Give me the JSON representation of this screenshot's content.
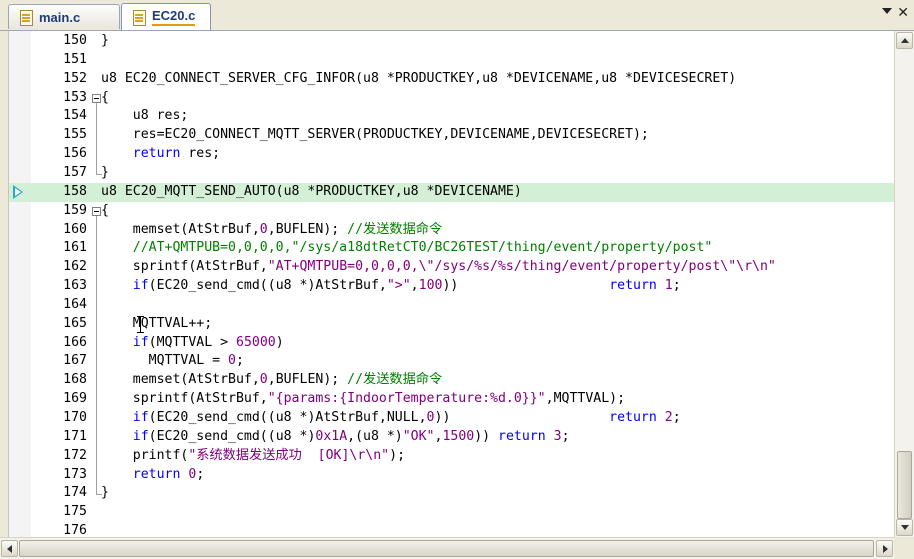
{
  "tabs": [
    {
      "label": "main.c",
      "active": false
    },
    {
      "label": "EC20.c",
      "active": true
    }
  ],
  "editor": {
    "current_line": "158",
    "lines": [
      {
        "n": "150",
        "tokens": [
          [
            "p",
            "}"
          ]
        ]
      },
      {
        "n": "151",
        "tokens": []
      },
      {
        "n": "152",
        "tokens": [
          [
            "p",
            "u8 EC20_CONNECT_SERVER_CFG_INFOR(u8 *PRODUCTKEY,u8 *DEVICENAME,u8 *DEVICESECRET)"
          ]
        ]
      },
      {
        "n": "153",
        "tokens": [
          [
            "p",
            "{"
          ]
        ]
      },
      {
        "n": "154",
        "tokens": [
          [
            "p",
            "    u8 res;"
          ]
        ]
      },
      {
        "n": "155",
        "tokens": [
          [
            "p",
            "    res=EC20_CONNECT_MQTT_SERVER(PRODUCTKEY,DEVICENAME,DEVICESECRET);"
          ]
        ]
      },
      {
        "n": "156",
        "tokens": [
          [
            "p",
            "    "
          ],
          [
            "kw",
            "return"
          ],
          [
            "p",
            " res;"
          ]
        ]
      },
      {
        "n": "157",
        "tokens": [
          [
            "p",
            "}"
          ]
        ]
      },
      {
        "n": "158",
        "tokens": [
          [
            "p",
            "u8 EC20_MQTT_SEND_AUTO(u8 *PRODUCTKEY,u8 *DEVICENAME)"
          ]
        ]
      },
      {
        "n": "159",
        "tokens": [
          [
            "p",
            "{"
          ]
        ]
      },
      {
        "n": "160",
        "tokens": [
          [
            "p",
            "    memset(AtStrBuf,"
          ],
          [
            "num",
            "0"
          ],
          [
            "p",
            ",BUFLEN); "
          ],
          [
            "cmt",
            "//发送数据命令"
          ]
        ]
      },
      {
        "n": "161",
        "tokens": [
          [
            "cmt",
            "    //AT+QMTPUB=0,0,0,0,\"/sys/a18dtRetCT0/BC26TEST/thing/event/property/post\""
          ]
        ]
      },
      {
        "n": "162",
        "tokens": [
          [
            "p",
            "    sprintf(AtStrBuf,"
          ],
          [
            "str",
            "\"AT+QMTPUB=0,0,0,0,\\\"/sys/%s/%s/thing/event/property/post\\\"\\r\\n\""
          ]
        ]
      },
      {
        "n": "163",
        "tokens": [
          [
            "p",
            "    "
          ],
          [
            "kw",
            "if"
          ],
          [
            "p",
            "(EC20_send_cmd((u8 *)AtStrBuf,"
          ],
          [
            "str",
            "\">\""
          ],
          [
            "p",
            ","
          ],
          [
            "num",
            "100"
          ],
          [
            "p",
            "))                   "
          ],
          [
            "kw",
            "return"
          ],
          [
            "p",
            " "
          ],
          [
            "num",
            "1"
          ],
          [
            "p",
            ";"
          ]
        ]
      },
      {
        "n": "164",
        "tokens": []
      },
      {
        "n": "165",
        "tokens": [
          [
            "p",
            "    MQTTVAL++;"
          ]
        ]
      },
      {
        "n": "166",
        "tokens": [
          [
            "p",
            "    "
          ],
          [
            "kw",
            "if"
          ],
          [
            "p",
            "(MQTTVAL > "
          ],
          [
            "num",
            "65000"
          ],
          [
            "p",
            ")"
          ]
        ]
      },
      {
        "n": "167",
        "tokens": [
          [
            "p",
            "      MQTTVAL = "
          ],
          [
            "num",
            "0"
          ],
          [
            "p",
            ";"
          ]
        ]
      },
      {
        "n": "168",
        "tokens": [
          [
            "p",
            "    memset(AtStrBuf,"
          ],
          [
            "num",
            "0"
          ],
          [
            "p",
            ",BUFLEN); "
          ],
          [
            "cmt",
            "//发送数据命令"
          ]
        ]
      },
      {
        "n": "169",
        "tokens": [
          [
            "p",
            "    sprintf(AtStrBuf,"
          ],
          [
            "str",
            "\"{params:{IndoorTemperature:%d.0}}\""
          ],
          [
            "p",
            ",MQTTVAL);"
          ]
        ]
      },
      {
        "n": "170",
        "tokens": [
          [
            "p",
            "    "
          ],
          [
            "kw",
            "if"
          ],
          [
            "p",
            "(EC20_send_cmd((u8 *)AtStrBuf,NULL,"
          ],
          [
            "num",
            "0"
          ],
          [
            "p",
            "))                    "
          ],
          [
            "kw",
            "return"
          ],
          [
            "p",
            " "
          ],
          [
            "num",
            "2"
          ],
          [
            "p",
            ";"
          ]
        ]
      },
      {
        "n": "171",
        "tokens": [
          [
            "p",
            "    "
          ],
          [
            "kw",
            "if"
          ],
          [
            "p",
            "(EC20_send_cmd((u8 *)"
          ],
          [
            "num",
            "0x1A"
          ],
          [
            "p",
            ",(u8 *)"
          ],
          [
            "str",
            "\"OK\""
          ],
          [
            "p",
            ","
          ],
          [
            "num",
            "1500"
          ],
          [
            "p",
            ")) "
          ],
          [
            "kw",
            "return"
          ],
          [
            "p",
            " "
          ],
          [
            "num",
            "3"
          ],
          [
            "p",
            ";"
          ]
        ]
      },
      {
        "n": "172",
        "tokens": [
          [
            "p",
            "    printf("
          ],
          [
            "str",
            "\"系统数据发送成功  [OK]\\r\\n\""
          ],
          [
            "p",
            ");"
          ]
        ]
      },
      {
        "n": "173",
        "tokens": [
          [
            "p",
            "    "
          ],
          [
            "kw",
            "return"
          ],
          [
            "p",
            " "
          ],
          [
            "num",
            "0"
          ],
          [
            "p",
            ";"
          ]
        ]
      },
      {
        "n": "174",
        "tokens": [
          [
            "p",
            "}"
          ]
        ]
      },
      {
        "n": "175",
        "tokens": []
      },
      {
        "n": "176",
        "tokens": []
      }
    ]
  },
  "colors": {
    "keyword": "#0000ff",
    "string": "#800080",
    "comment": "#008000",
    "current_line_bg": "#d3f0d6",
    "exec_arrow": "#27a7d4"
  },
  "icons": {
    "tab_file": "c-file-icon",
    "exec_pointer": "current-line-arrow-icon",
    "fold": "fold-minus-icon",
    "menu": "tab-list-dropdown-icon",
    "close": "close-icon"
  }
}
